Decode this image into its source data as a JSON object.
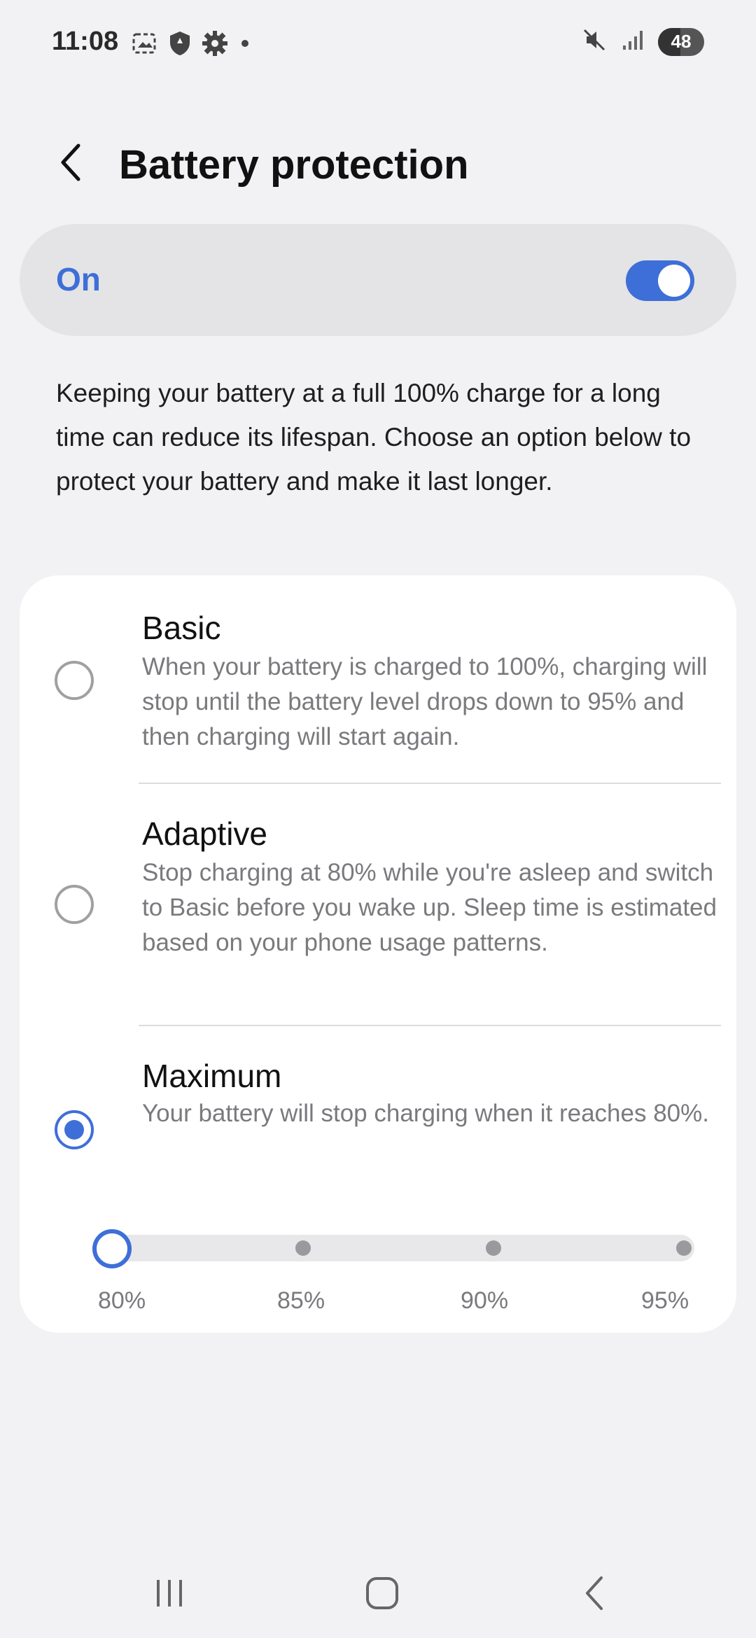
{
  "status_bar": {
    "time": "11:08",
    "battery_level": "48",
    "icons_left": [
      "screenshot-icon",
      "shield-icon",
      "gear-icon",
      "dot-icon"
    ],
    "icons_right": [
      "mute-icon",
      "signal-icon",
      "battery-icon"
    ]
  },
  "header": {
    "title": "Battery protection"
  },
  "master_switch": {
    "label": "On",
    "enabled": true
  },
  "description": "Keeping your battery at a full 100% charge for a long time can reduce its lifespan. Choose an option below to protect your battery and make it last longer.",
  "options": [
    {
      "title": "Basic",
      "description": "When your battery is charged to 100%, charging will stop until the battery level drops down to 95% and then charging will start again.",
      "selected": false
    },
    {
      "title": "Adaptive",
      "description": "Stop charging at 80% while you're asleep and switch to Basic before you wake up. Sleep time is estimated based on your phone usage patterns.",
      "selected": false
    },
    {
      "title": "Maximum",
      "description": "Your battery will stop charging when it reaches 80%.",
      "selected": true
    }
  ],
  "slider": {
    "labels": [
      "80%",
      "85%",
      "90%",
      "95%"
    ],
    "selected": "80%"
  },
  "colors": {
    "accent": "#3e6fd8",
    "background": "#f2f2f4",
    "card": "#ffffff",
    "switch_bg": "#e4e4e6",
    "secondary_text": "#7a7a7e"
  },
  "nav_bar": {
    "buttons": [
      "recents-icon",
      "home-icon",
      "back-icon"
    ]
  }
}
